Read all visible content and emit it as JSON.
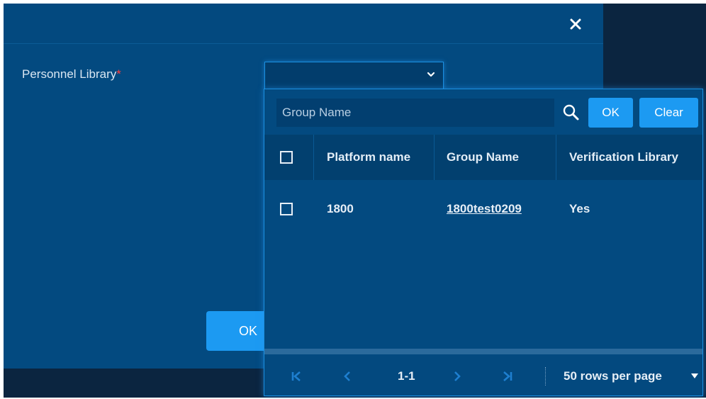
{
  "dialog": {
    "close_glyph": "✕",
    "field_label": "Personnel Library",
    "required_mark": "*",
    "ok_label": "OK"
  },
  "dropdown": {
    "search_placeholder": "Group Name",
    "ok_label": "OK",
    "clear_label": "Clear",
    "columns": [
      "Platform name",
      "Group Name",
      "Verification Library"
    ],
    "rows": [
      {
        "platform_name": "1800",
        "group_name": "1800test0209",
        "verification_library": "Yes"
      }
    ],
    "pagination": {
      "range": "1-1",
      "rows_per_page": "50 rows per page"
    }
  },
  "colors": {
    "accent": "#1c9af2",
    "panel_bg": "#034a80",
    "required": "#ff3b3b"
  }
}
